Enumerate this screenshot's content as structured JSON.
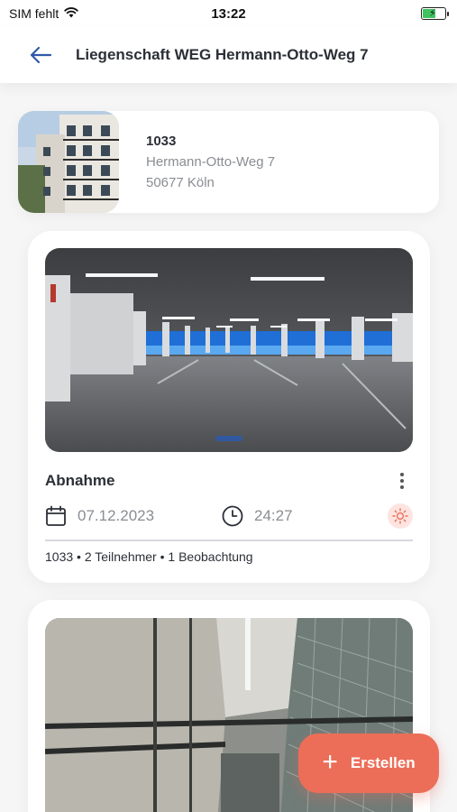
{
  "status_bar": {
    "carrier": "SIM fehlt",
    "time": "13:22",
    "battery_percent": 60
  },
  "header": {
    "title": "Liegenschaft WEG Hermann-Otto-Weg 7",
    "back_icon": "arrow-left-icon"
  },
  "property": {
    "id": "1033",
    "street": "Hermann-Otto-Weg 7",
    "city": "50677 Köln"
  },
  "inspections": [
    {
      "title": "Abnahme",
      "date": "07.12.2023",
      "time": "24:27",
      "summary": "1033 • 2 Teilnehmer • 1 Beobachtung",
      "weather_icon": "sun-icon"
    }
  ],
  "fab": {
    "label": "Erstellen"
  },
  "colors": {
    "accent": "#ec6e58",
    "accent_soft": "#fde4e0",
    "text_primary": "#2b2f36",
    "text_secondary": "#8a8d92",
    "header_icon": "#2f5aa8"
  }
}
